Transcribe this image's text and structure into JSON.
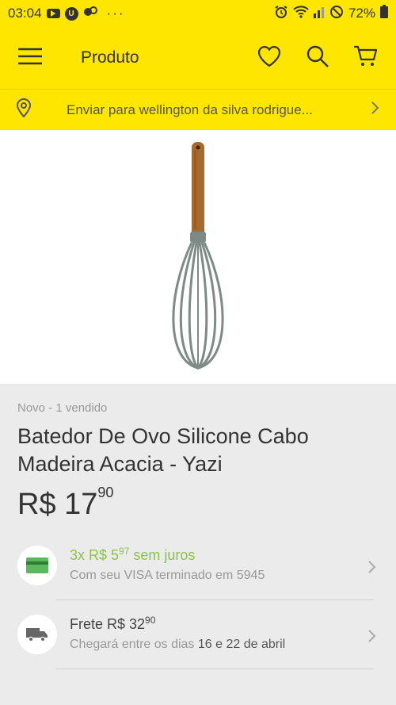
{
  "status_bar": {
    "time": "03:04",
    "battery": "72%",
    "icons": [
      "youtube-icon",
      "u-app-icon",
      "messenger-icon",
      "alarm-icon",
      "wifi-icon",
      "signal-icon",
      "dnd-icon",
      "battery-icon"
    ]
  },
  "header": {
    "title": "Produto",
    "icons": [
      "menu-icon",
      "heart-icon",
      "search-icon",
      "cart-icon"
    ]
  },
  "shipping_bar": {
    "text": "Enviar para wellington da silva rodrigue..."
  },
  "product": {
    "condition": "Novo - 1 vendido",
    "title": "Batedor De Ovo Silicone Cabo Madeira Acacia - Yazi",
    "currency": "R$",
    "price_int": "17",
    "price_cents": "90"
  },
  "payment": {
    "installments_prefix": "3x R$ 5",
    "installments_cents": "97",
    "installments_suffix": " sem juros",
    "card_text": "Com seu VISA terminado em 5945"
  },
  "shipping": {
    "label": "Frete R$ 32",
    "cents": "90",
    "arrival_prefix": "Chegará entre os dias ",
    "arrival_dates": "16 e 22 de abril"
  },
  "colors": {
    "brand_yellow": "#ffe600",
    "green": "#8bc34a",
    "text": "#333333",
    "muted": "#999999"
  }
}
